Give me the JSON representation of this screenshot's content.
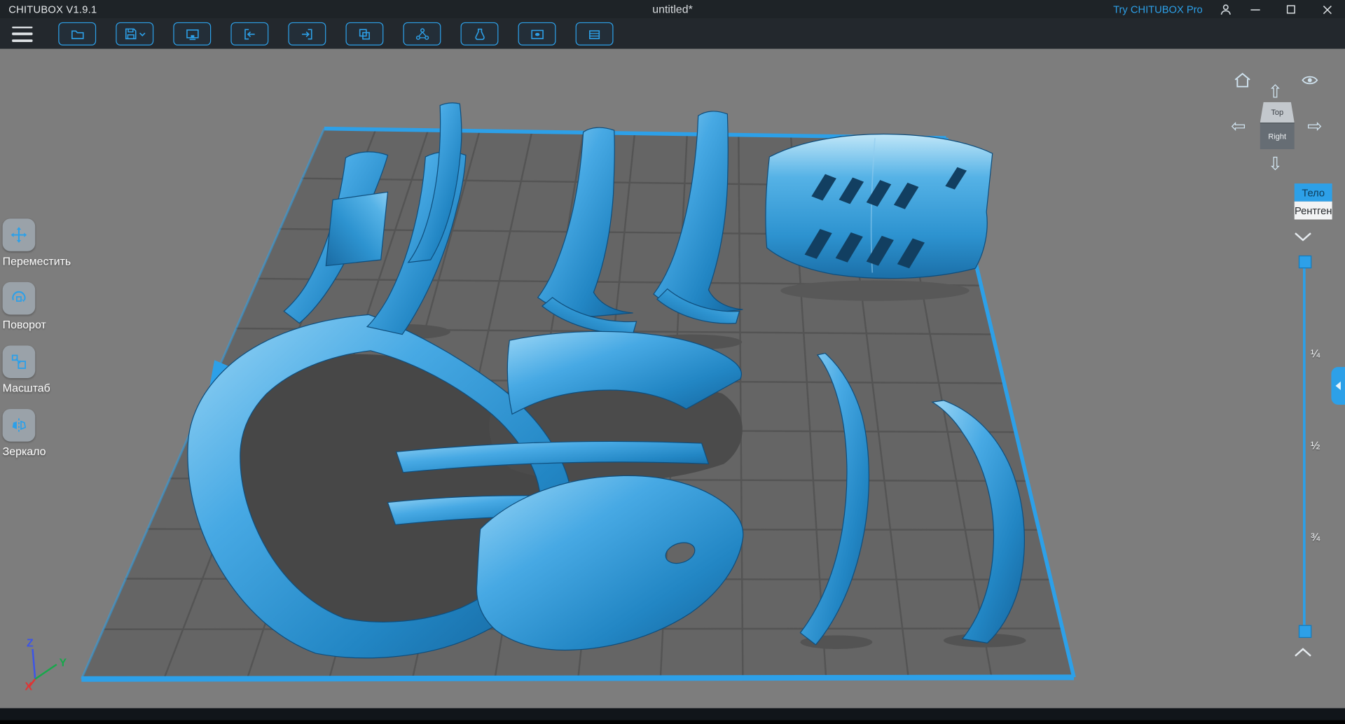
{
  "titlebar": {
    "app_title": "CHITUBOX V1.9.1",
    "document_title": "untitled*",
    "pro_link": "Try CHITUBOX Pro"
  },
  "toolbar": {
    "icons": [
      "open-file",
      "save",
      "screenshot",
      "import",
      "export",
      "copy",
      "auto-layout",
      "hollow",
      "dig-hole",
      "slice"
    ]
  },
  "left_tools": [
    {
      "label": "Переместить",
      "icon": "move-icon"
    },
    {
      "label": "Поворот",
      "icon": "rotate-icon"
    },
    {
      "label": "Масштаб",
      "icon": "scale-icon"
    },
    {
      "label": "Зеркало",
      "icon": "mirror-icon"
    }
  ],
  "view_gizmo": {
    "faces": [
      {
        "label": "Top"
      },
      {
        "label": "Right"
      }
    ],
    "icons": [
      "home-icon",
      "view-eye-icon",
      "arrow-up-icon",
      "arrow-left-icon",
      "arrow-right-icon",
      "arrow-down-icon"
    ]
  },
  "render_modes": [
    {
      "label": "Тело",
      "active": true
    },
    {
      "label": "Рентген",
      "active": false
    }
  ],
  "clip_slider": {
    "labels": [
      "¼",
      "½",
      "¾"
    ]
  },
  "axes": [
    {
      "label": "Z",
      "color": "#3c55e8"
    },
    {
      "label": "Y",
      "color": "#17a84b"
    },
    {
      "label": "X",
      "color": "#e03434"
    }
  ],
  "scene": {
    "model_color": "#2d9ee4",
    "parts": [
      "fender-strip-left",
      "side-panel-left",
      "center-blade",
      "front-fender-left",
      "front-fender-right",
      "hood",
      "body-side-frame",
      "roof-panel",
      "side-skirt-upper",
      "side-skirt-lower",
      "rear-quarter-panel",
      "wheel-arch-trim",
      "spoiler"
    ]
  },
  "colors": {
    "accent": "#2da0e8",
    "viewport_bg": "#7d7d7d",
    "plate": "#656565"
  }
}
